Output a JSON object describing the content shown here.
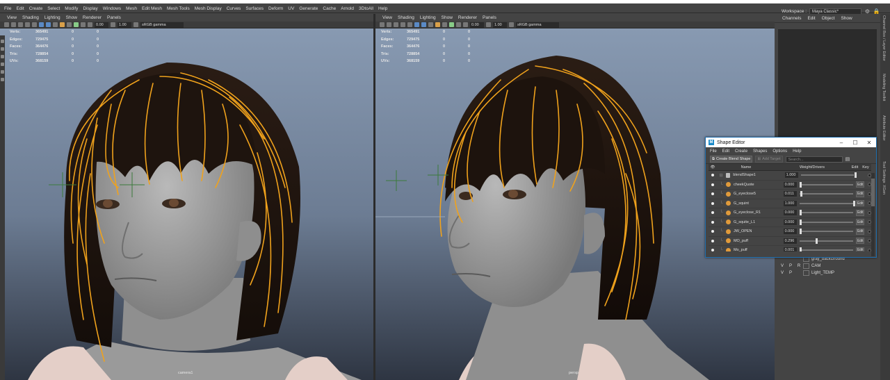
{
  "menubar": {
    "items": [
      "File",
      "Edit",
      "Create",
      "Select",
      "Modify",
      "Display",
      "Windows",
      "Mesh",
      "Edit Mesh",
      "Mesh Tools",
      "Mesh Display",
      "Curves",
      "Surfaces",
      "Deform",
      "UV",
      "Generate",
      "Cache",
      "Arnold",
      "3DtoAll",
      "Help"
    ],
    "workspace_label": "Workspace :",
    "workspace_value": "Maya Classic*"
  },
  "viewport_menu": [
    "View",
    "Shading",
    "Lighting",
    "Show",
    "Renderer",
    "Panels"
  ],
  "viewport_toolbar": {
    "value_a": "0.00",
    "value_b": "1.00",
    "colorspace": "sRGB gamma"
  },
  "hud": {
    "rows": [
      {
        "label": "Verts:",
        "value": "365491",
        "sel": "0",
        "extra": "0"
      },
      {
        "label": "Edges:",
        "value": "729475",
        "sel": "0",
        "extra": "0"
      },
      {
        "label": "Faces:",
        "value": "364476",
        "sel": "0",
        "extra": "0"
      },
      {
        "label": "Tris:",
        "value": "728854",
        "sel": "0",
        "extra": "0"
      },
      {
        "label": "UVs:",
        "value": "368159",
        "sel": "0",
        "extra": "0"
      }
    ]
  },
  "viewports": {
    "left_camera": "camera1",
    "right_camera": "persp"
  },
  "channel_box": {
    "tabs": [
      "Channels",
      "Edit",
      "Object",
      "Show"
    ]
  },
  "layers": [
    {
      "v": "",
      "p": "",
      "r": "",
      "name": "gray_backGround"
    },
    {
      "v": "V",
      "p": "P",
      "r": "R",
      "name": "CAM"
    },
    {
      "v": "V",
      "p": "P",
      "r": "",
      "name": "Light_TEMP"
    }
  ],
  "side_tabs": [
    "Channel Box / Layer Editor",
    "Modeling Toolkit",
    "Attribute Editor",
    "Tool Settings",
    "XGen"
  ],
  "shape_editor": {
    "title": "Shape Editor",
    "menu": [
      "File",
      "Edit",
      "Create",
      "Shapes",
      "Options",
      "Help"
    ],
    "create_label": "Create Blend Shape",
    "add_target_label": "Add Target",
    "search_placeholder": "Search...",
    "columns": {
      "name": "Name",
      "weight": "Weight/Drivers",
      "edit": "Edit",
      "key": "Key"
    },
    "edit_label": "Edit",
    "group": {
      "name": "blendShape1",
      "value": "1.000"
    },
    "targets": [
      {
        "name": "cheekQuote",
        "value": "0.000",
        "weight": 0.0
      },
      {
        "name": "G_eyeclose5",
        "value": "0.011",
        "weight": 0.011
      },
      {
        "name": "G_squint",
        "value": "1.000",
        "weight": 1.0
      },
      {
        "name": "G_eyeclose_R1",
        "value": "0.000",
        "weight": 0.0
      },
      {
        "name": "G_squite_L1",
        "value": "0.000",
        "weight": 0.0
      },
      {
        "name": "JW_OPEN",
        "value": "0.000",
        "weight": 0.0
      },
      {
        "name": "MO_puff",
        "value": "0.296",
        "weight": 0.296
      },
      {
        "name": "Mo_puff",
        "value": "0.001",
        "weight": 0.001
      }
    ]
  }
}
